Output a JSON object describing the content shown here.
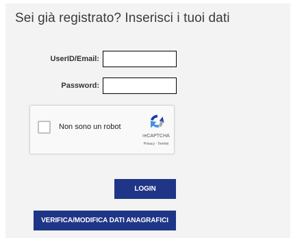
{
  "login": {
    "title": "Sei già registrato? Inserisci i tuoi dati",
    "userid_label": "UserID/Email:",
    "userid_value": "",
    "password_label": "Password:",
    "password_value": ""
  },
  "recaptcha": {
    "label": "Non sono un robot",
    "brand": "reCAPTCHA",
    "links": "Privacy - Termini",
    "checked": false,
    "icon": "recaptcha-logo-icon"
  },
  "buttons": {
    "login_label": "LOGIN",
    "verify_label": "VERIFICA/MODIFICA DATI ANAGRAFICI"
  },
  "colors": {
    "panel_bg": "#f3f3f3",
    "button_bg": "#1f3587",
    "button_text": "#ffffff"
  }
}
